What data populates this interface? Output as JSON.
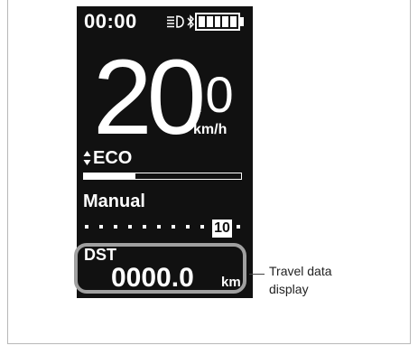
{
  "display": {
    "clock": "00:00",
    "speed": {
      "integer": "20",
      "decimal": ".0",
      "unit": "km/h"
    },
    "assist": {
      "mode": "ECO",
      "level_fraction": 0.33
    },
    "shift": {
      "mode": "Manual",
      "gear": "10"
    },
    "travel": {
      "label": "DST",
      "value": "0000.0",
      "unit": "km"
    },
    "battery": {
      "bars": 5
    },
    "icons": [
      "light-icon",
      "bluetooth-icon",
      "battery-icon",
      "assist-arrows-icon"
    ]
  },
  "callout": {
    "line1": "Travel data",
    "line2": "display"
  },
  "colors": {
    "screen": "#111111",
    "foreground": "#ffffff",
    "highlight_frame": "#a0a0a0"
  }
}
